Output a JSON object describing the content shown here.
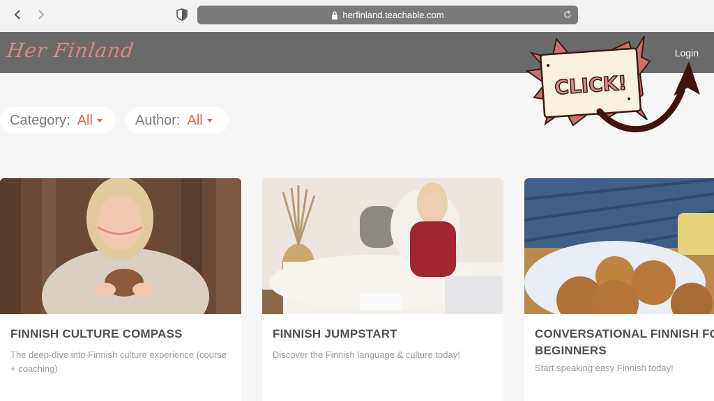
{
  "browser": {
    "url": "herfinland.teachable.com",
    "icons": [
      "back-icon",
      "forward-icon",
      "shield-icon",
      "lock-icon",
      "reload-icon"
    ]
  },
  "header": {
    "logo": "Her Finland",
    "login": "Login"
  },
  "sticker": {
    "text": "CLICK!"
  },
  "filters": [
    {
      "label": "Category:",
      "value": "All"
    },
    {
      "label": "Author:",
      "value": "All"
    }
  ],
  "courses": [
    {
      "title": "FINNISH CULTURE COMPASS",
      "description": "The deep-dive into Finnish culture experience (course + coaching)"
    },
    {
      "title": "FINNISH JUMPSTART",
      "description": "Discover the Finnish language & culture today!"
    },
    {
      "title": "CONVERSATIONAL FINNISH FOR BEGINNERS",
      "description": "Start speaking easy Finnish today!"
    }
  ],
  "colors": {
    "header_bg": "#6b6a6a",
    "accent": "#e0665b",
    "logo": "#d98a82",
    "url_bar": "#7a7a7a"
  }
}
